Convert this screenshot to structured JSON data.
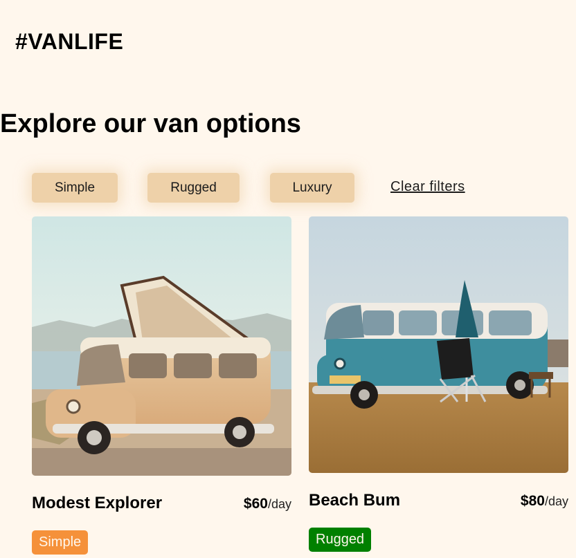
{
  "header": {
    "logo": "#VANLIFE"
  },
  "main": {
    "title": "Explore our van options",
    "filters": [
      {
        "label": "Simple"
      },
      {
        "label": "Rugged"
      },
      {
        "label": "Luxury"
      }
    ],
    "clear_filters": "Clear filters"
  },
  "vans": [
    {
      "name": "Modest Explorer",
      "price": "$60",
      "price_unit": "/day",
      "type": "Simple",
      "type_color": "#E17654",
      "image": "vintage-camper-van-photo"
    },
    {
      "name": "Beach Bum",
      "price": "$80",
      "price_unit": "/day",
      "type": "Rugged",
      "type_color": "#115E59",
      "image": "teal-vw-van-photo"
    }
  ],
  "colors": {
    "background": "#FFF7ED",
    "filter_button": "#EED1A9",
    "simple_badge": "#F5913A",
    "rugged_badge": "#008000"
  }
}
